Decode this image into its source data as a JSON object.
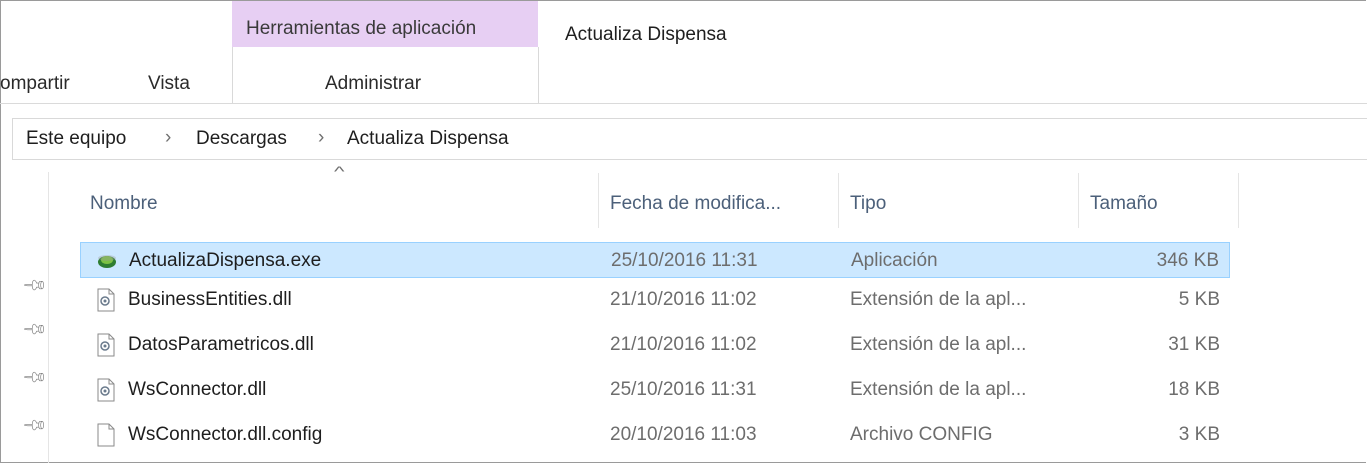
{
  "ribbon": {
    "context_group_label": "Herramientas de aplicación",
    "window_title": "Actualiza Dispensa",
    "tabs": [
      "ompartir",
      "Vista",
      "Administrar"
    ]
  },
  "breadcrumb": [
    "Este equipo",
    "Descargas",
    "Actualiza Dispensa"
  ],
  "columns": {
    "name": "Nombre",
    "date": "Fecha de modifica...",
    "type": "Tipo",
    "size": "Tamaño"
  },
  "files": [
    {
      "name": "ActualizaDispensa.exe",
      "date": "25/10/2016 11:31",
      "type": "Aplicación",
      "size": "346 KB",
      "icon": "exe-app-icon",
      "selected": true
    },
    {
      "name": "BusinessEntities.dll",
      "date": "21/10/2016 11:02",
      "type": "Extensión de la apl...",
      "size": "5 KB",
      "icon": "dll-icon"
    },
    {
      "name": "DatosParametricos.dll",
      "date": "21/10/2016 11:02",
      "type": "Extensión de la apl...",
      "size": "31 KB",
      "icon": "dll-icon"
    },
    {
      "name": "WsConnector.dll",
      "date": "25/10/2016 11:31",
      "type": "Extensión de la apl...",
      "size": "18 KB",
      "icon": "dll-icon"
    },
    {
      "name": "WsConnector.dll.config",
      "date": "20/10/2016 11:03",
      "type": "Archivo CONFIG",
      "size": "3 KB",
      "icon": "blank-file-icon"
    }
  ],
  "colors": {
    "context_tab": "#e7cff3",
    "selection_bg": "#cce8ff",
    "selection_border": "#99d1ff",
    "header_text": "#4c607a"
  }
}
